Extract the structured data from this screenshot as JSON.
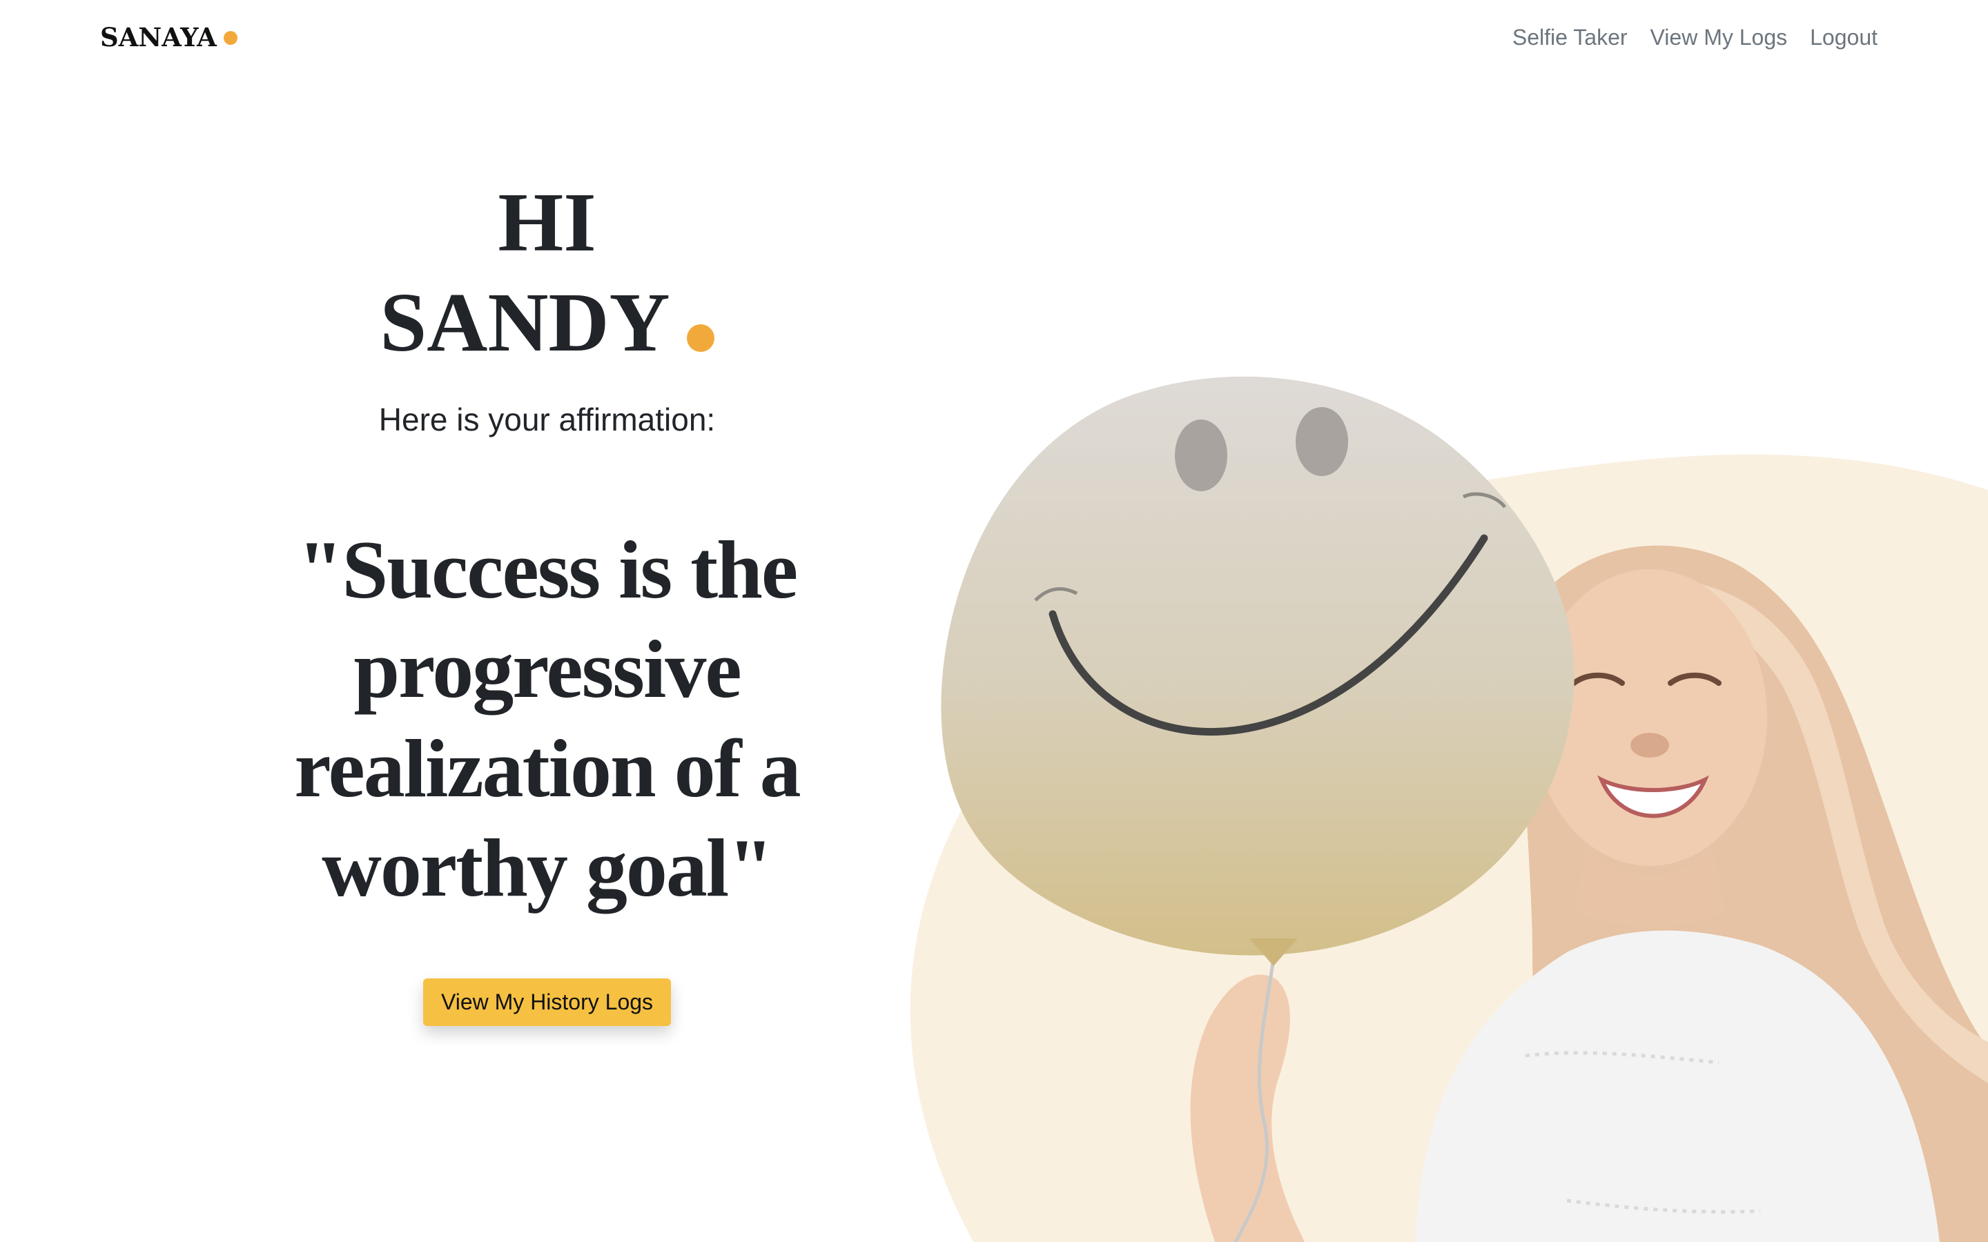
{
  "nav": {
    "brand": "SANAYA",
    "links": [
      "Selfie Taker",
      "View My Logs",
      "Logout"
    ]
  },
  "hero": {
    "greeting_line1": "HI",
    "greeting_line2": "SANDY",
    "subtitle": "Here is your affirmation:",
    "affirmation": "\"Success is the progressive realization of a worthy goal\"",
    "cta_label": "View My History Logs"
  },
  "colors": {
    "accent": "#f2a93b",
    "button": "#f6c042",
    "blob": "#faf0e0",
    "text": "#212529",
    "nav_text": "#6c757d"
  },
  "icons": {
    "image": "smiling-woman-with-smiley-balloon"
  }
}
